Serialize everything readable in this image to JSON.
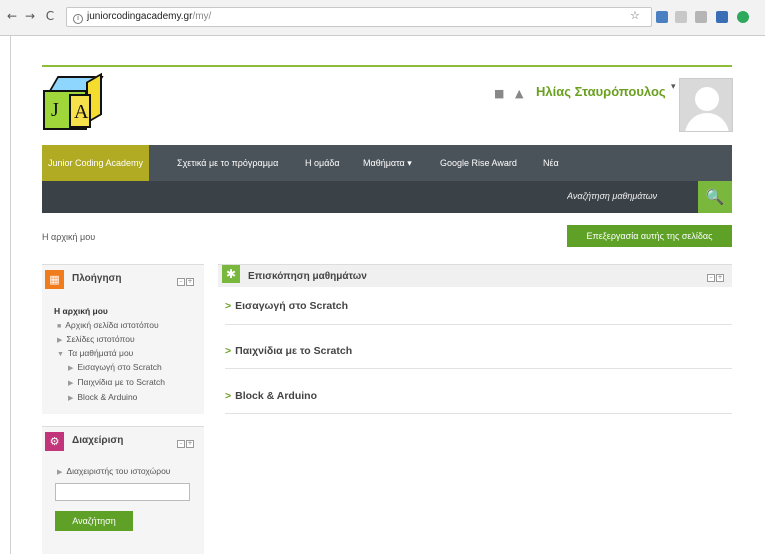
{
  "browser": {
    "back": "←",
    "forward": "→",
    "reload": "C",
    "info_icon": "i",
    "url_host": "juniorcodingacademy.gr",
    "url_path": "/my/",
    "star": "☆"
  },
  "header": {
    "logo_letters": [
      "J",
      "A"
    ],
    "user_name": "Ηλίας Σταυρόπουλος",
    "caret": "▾",
    "icons": [
      "message-icon",
      "bell-icon"
    ]
  },
  "navbar": {
    "items": [
      {
        "label": "Junior Coding Academy",
        "active": true
      },
      {
        "label": "Σχετικά με το πρόγραμμα"
      },
      {
        "label": "Η ομάδα"
      },
      {
        "label": "Μαθήματα ▾"
      },
      {
        "label": "Google Rise Award"
      },
      {
        "label": "Νέα"
      }
    ],
    "search_placeholder": "Αναζήτηση μαθημάτων",
    "search_icon": "🔍"
  },
  "breadcrumb": "Η αρχική μου",
  "edit_button": "Επεξεργασία αυτής της σελίδας",
  "navigation_block": {
    "title": "Πλοήγηση",
    "items": [
      "Η αρχική μου",
      "Αρχική σελίδα ιστοτόπου",
      "Σελίδες ιστοτόπου",
      "Τα μαθήματά μου",
      "Εισαγωγή στο Scratch",
      "Παιχνίδια με το Scratch",
      "Block & Arduino"
    ]
  },
  "admin_block": {
    "title": "Διαχείριση",
    "item": "Διαχειριστής του ιστοχώρου",
    "search_button": "Αναζήτηση"
  },
  "overview": {
    "title": "Επισκόπηση μαθημάτων",
    "courses": [
      "Εισαγωγή στο Scratch",
      "Παιχνίδια με το Scratch",
      "Block & Arduino"
    ]
  },
  "colors": {
    "accent_green": "#79b83c",
    "nav_dark": "#4b535a",
    "nav_active": "#b0ab22",
    "nav_icon_orange": "#f07c1e",
    "admin_icon_pink": "#c2357a"
  }
}
